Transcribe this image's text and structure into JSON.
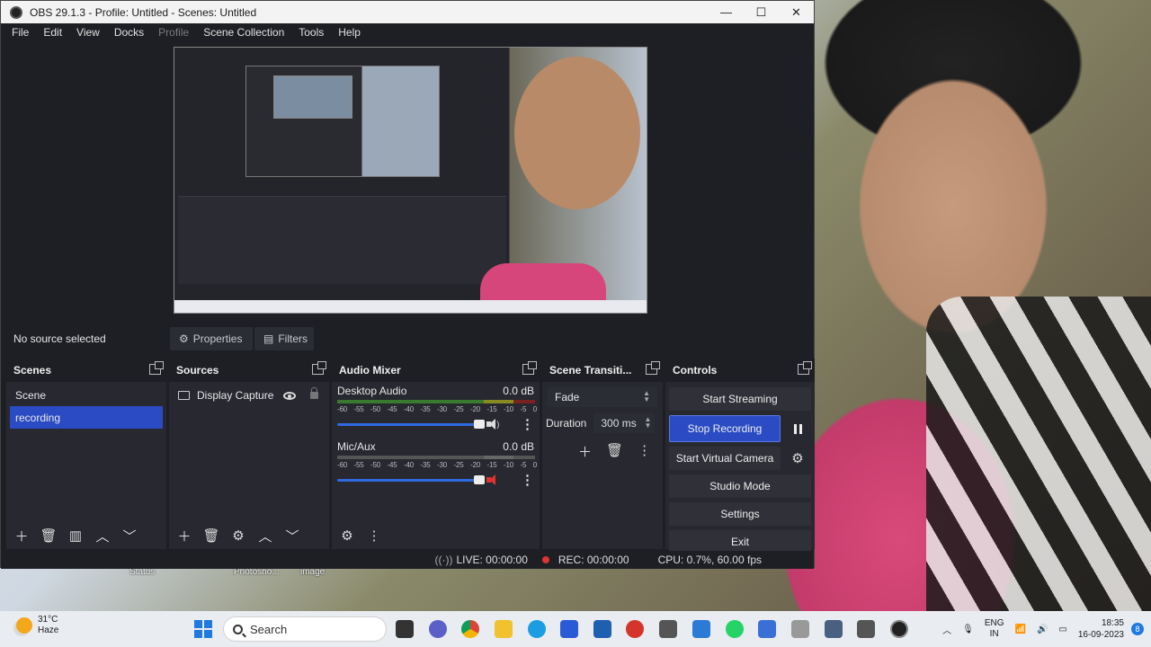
{
  "window": {
    "title": "OBS 29.1.3 - Profile: Untitled - Scenes: Untitled",
    "controls": {
      "minimize": "—",
      "maximize": "☐",
      "close": "✕"
    }
  },
  "menu": [
    "File",
    "Edit",
    "View",
    "Docks",
    "Profile",
    "Scene Collection",
    "Tools",
    "Help"
  ],
  "source_bar": {
    "no_source": "No source selected",
    "properties": "Properties",
    "filters": "Filters"
  },
  "scenes": {
    "title": "Scenes",
    "items": [
      "Scene",
      "recording"
    ],
    "selected": "recording"
  },
  "sources": {
    "title": "Sources",
    "items": [
      {
        "name": "Display Capture",
        "icon": "monitor-icon",
        "visible": true,
        "locked": false
      }
    ]
  },
  "audio_mixer": {
    "title": "Audio Mixer",
    "ticks": [
      "-60",
      "-55",
      "-50",
      "-45",
      "-40",
      "-35",
      "-30",
      "-25",
      "-20",
      "-15",
      "-10",
      "-5",
      "0"
    ],
    "channels": [
      {
        "name": "Desktop Audio",
        "level": "0.0 dB",
        "muted": false,
        "volume_fraction": 1.0
      },
      {
        "name": "Mic/Aux",
        "level": "0.0 dB",
        "muted": true,
        "volume_fraction": 1.0
      }
    ]
  },
  "transitions": {
    "title": "Scene Transiti...",
    "selected": "Fade",
    "duration_label": "Duration",
    "duration_value": "300 ms"
  },
  "controls": {
    "title": "Controls",
    "start_streaming": "Start Streaming",
    "stop_recording": "Stop Recording",
    "start_virtual_camera": "Start Virtual Camera",
    "studio_mode": "Studio Mode",
    "settings": "Settings",
    "exit": "Exit"
  },
  "status": {
    "live": "LIVE: 00:00:00",
    "rec": "REC: 00:00:00",
    "cpu": "CPU: 0.7%, 60.00 fps"
  },
  "desktop_labels": [
    "Status",
    "Photosho...",
    "image"
  ],
  "taskbar": {
    "weather_temp": "31°C",
    "weather_desc": "Haze",
    "search_label": "Search",
    "lang_top": "ENG",
    "lang_bottom": "IN",
    "time": "18:35",
    "date": "16-09-2023",
    "notifications": "8"
  },
  "colors": {
    "accent": "#2a4bc4",
    "dock_bg": "#272830",
    "window_bg": "#1e1f25",
    "record": "#dd3333"
  }
}
